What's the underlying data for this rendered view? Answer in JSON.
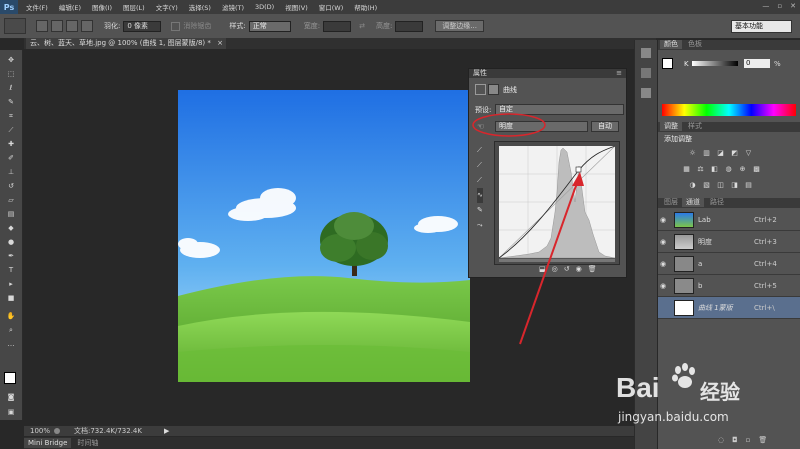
{
  "app": {
    "logo": "Ps"
  },
  "menu": [
    "文件(F)",
    "编辑(E)",
    "图像(I)",
    "图层(L)",
    "文字(Y)",
    "选择(S)",
    "滤镜(T)",
    "3D(D)",
    "视图(V)",
    "窗口(W)",
    "帮助(H)"
  ],
  "window_controls": [
    "—",
    "▫",
    "✕"
  ],
  "options": {
    "feather_label": "羽化:",
    "feather_value": "0 像素",
    "antialias_label": "消除锯齿",
    "style_label": "样式:",
    "style_value": "正常",
    "width_label": "宽度:",
    "height_label": "高度:",
    "refine_edge": "调整边缘...",
    "workspace": "基本功能"
  },
  "document": {
    "tab_title": "云、树、蓝天、草地.jpg @ 100% (曲线 1, 图层蒙版/8) *",
    "close": "×"
  },
  "status": {
    "zoom": "100%",
    "doc_info": "文档:732.4K/732.4K"
  },
  "bottom_tabs": [
    "Mini Bridge",
    "时间轴"
  ],
  "properties": {
    "tab": "属性",
    "title": "曲线",
    "preset_label": "预设:",
    "preset_value": "自定",
    "channel_value": "明度",
    "auto_button": "自动"
  },
  "color_panel": {
    "tabs": [
      "颜色",
      "色板"
    ],
    "k_label": "K",
    "k_value": "0",
    "percent": "%"
  },
  "adjustments_panel": {
    "tabs": [
      "调整",
      "样式"
    ],
    "heading": "添加调整"
  },
  "layers_panel": {
    "tabs": [
      "图层",
      "通道",
      "路径"
    ],
    "rows": [
      {
        "name": "Lab",
        "shortcut": "Ctrl+2"
      },
      {
        "name": "明度",
        "shortcut": "Ctrl+3"
      },
      {
        "name": "a",
        "shortcut": "Ctrl+4"
      },
      {
        "name": "b",
        "shortcut": "Ctrl+5"
      },
      {
        "name": "曲线 1蒙版",
        "shortcut": "Ctrl+\\"
      }
    ]
  },
  "watermark": {
    "brand": "Bai",
    "brand_cn": "经验",
    "url": "jingyan.baidu.com"
  },
  "colors": {
    "accent_red": "#d8262c",
    "selected_row": "#5a6f8e"
  }
}
